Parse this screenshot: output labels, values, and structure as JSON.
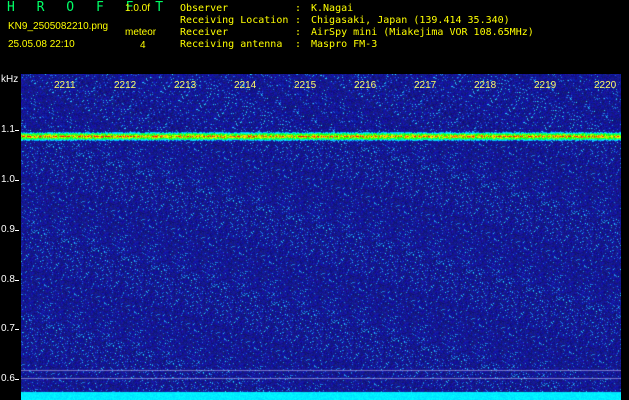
{
  "header": {
    "app_title": "H R O F F T",
    "version": "1.0.0f",
    "filename": "KN9_2505082210.png",
    "mode": "meteor",
    "timestamp": "25.05.08 22:10",
    "count": "4",
    "info": [
      {
        "label": "Observer",
        "sep": ":",
        "value": "K.Nagai"
      },
      {
        "label": "Receiving Location",
        "sep": ":",
        "value": "Chigasaki, Japan (139.414 35.340)"
      },
      {
        "label": "Receiver",
        "sep": ":",
        "value": "AirSpy mini (Miakejima VOR 108.65MHz)"
      },
      {
        "label": "Receiving antenna",
        "sep": ":",
        "value": "Maspro FM-3"
      }
    ]
  },
  "spectrogram": {
    "unit": "kHz",
    "y_labels": [
      "1.1",
      "1.0",
      "0.9",
      "0.8",
      "0.7",
      "0.6"
    ],
    "x_labels": [
      "2211",
      "2212",
      "2213",
      "2214",
      "2215",
      "2216",
      "2217",
      "2218",
      "2219",
      "2220"
    ],
    "colors": {
      "background": "#000000",
      "label": "#ffffff",
      "time_label": "#ffff66",
      "noise_floor": "#1a1aa0",
      "carrier": "#ff6a00",
      "baseline": "#00e5ff"
    }
  }
}
